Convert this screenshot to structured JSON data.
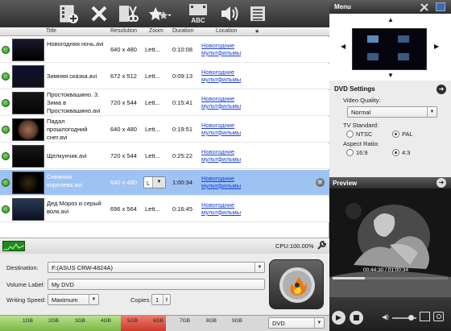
{
  "toolbar": {
    "icons": [
      "add-file-icon",
      "remove-icon",
      "cut-icon",
      "effects-icon",
      "subtitle-icon",
      "audio-icon",
      "chapters-icon"
    ],
    "abc_label": "ABC"
  },
  "list": {
    "headers": {
      "title": "Title",
      "resolution": "Resolution",
      "zoom": "Zoom",
      "duration": "Duration",
      "location": "Location",
      "star": "★"
    },
    "rows": [
      {
        "title": "Новогодняя ночь.avi",
        "resolution": "640 x 480",
        "zoom": "Lett...",
        "duration": "0:10:08",
        "location": "Новогодние мультфильмы"
      },
      {
        "title": "Зимняя сказка.avi",
        "resolution": "672 x 512",
        "zoom": "Lett...",
        "duration": "0:09:13",
        "location": "Новогодние мультфильмы"
      },
      {
        "title": "Простоквашино. 3. Зима в Простоквашино.avi",
        "resolution": "720 x 544",
        "zoom": "Lett...",
        "duration": "0:15:41",
        "location": "Новогодние мультфильмы"
      },
      {
        "title": "Падал прошлогодний снег.avi",
        "resolution": "640 x 480",
        "zoom": "Lett...",
        "duration": "0:19:51",
        "location": "Новогодние мультфильмы"
      },
      {
        "title": "Щелкунчик.avi",
        "resolution": "720 x 544",
        "zoom": "Lett...",
        "duration": "0:25:22",
        "location": "Новогодние мультфильмы"
      },
      {
        "title": "Снежная королева.avi",
        "resolution": "640 x 480",
        "zoom": "L",
        "duration": "1:00:34",
        "location": "Новогодние мультфильмы"
      },
      {
        "title": "Дед Мороз и серый волк.avi",
        "resolution": "696 x 564",
        "zoom": "Lett...",
        "duration": "0:16:45",
        "location": "Новогодние мультфильмы"
      }
    ]
  },
  "status": {
    "cpu": "CPU:100.00%"
  },
  "form": {
    "destination_label": "Destination:",
    "destination_value": "F:(ASUS CRW-4824A)",
    "volume_label": "Volume Label:",
    "volume_value": "My DVD",
    "speed_label": "Writing Speed:",
    "speed_value": "Maximum",
    "copies_label": "Copies:",
    "copies_value": "1"
  },
  "capacity": {
    "ticks": [
      "1GB",
      "2GB",
      "3GB",
      "4GB",
      "5GB",
      "6GB",
      "7GB",
      "8GB",
      "9GB"
    ],
    "disc_type": "DVD"
  },
  "right": {
    "menu_title": "Menu",
    "dvd_settings_title": "DVD Settings",
    "video_quality_label": "Video Quality:",
    "video_quality_value": "Normal",
    "tv_standard_label": "TV Standard:",
    "ntsc": "NTSC",
    "pal": "PAL",
    "aspect_label": "Aspect Ratio:",
    "ratio_169": "16:9",
    "ratio_43": "4:3",
    "preview_title": "Preview",
    "time": "00:44:30 / 01:00:34"
  },
  "colors": {
    "accent": "#9ec3f3",
    "link": "#1a3fd0",
    "toolbar": "#3a3a3a"
  }
}
